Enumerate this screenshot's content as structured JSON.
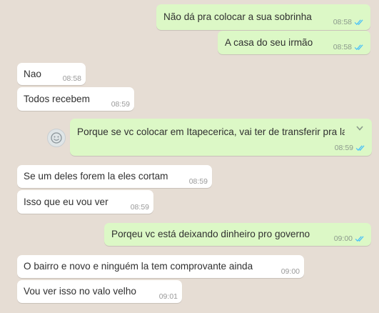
{
  "messages": [
    {
      "text": "Não dá pra colocar a sua sobrinha",
      "time": "08:58",
      "direction": "out",
      "read": true
    },
    {
      "text": "A casa do seu irmão",
      "time": "08:58",
      "direction": "out",
      "read": true
    },
    {
      "text": "Nao",
      "time": "08:58",
      "direction": "in"
    },
    {
      "text": "Todos recebem",
      "time": "08:59",
      "direction": "in"
    },
    {
      "text": "Porque se vc colocar em Itapecerica, vai ter de transferir pra la",
      "time": "08:59",
      "direction": "out",
      "read": true
    },
    {
      "text": "Se um deles forem la eles cortam",
      "time": "08:59",
      "direction": "in"
    },
    {
      "text": "Isso que eu vou ver",
      "time": "08:59",
      "direction": "in"
    },
    {
      "text": "Porqeu vc está deixando dinheiro pro governo",
      "time": "09:00",
      "direction": "out",
      "read": true
    },
    {
      "text": "O bairro e novo e ninguém la tem comprovante ainda",
      "time": "09:00",
      "direction": "in"
    },
    {
      "text": "Vou ver isso no valo velho",
      "time": "09:01",
      "direction": "in"
    }
  ],
  "colors": {
    "background": "#e6ddd4",
    "outgoing_bubble": "#dcf8c6",
    "incoming_bubble": "#ffffff",
    "read_ticks": "#4fc3f7"
  },
  "icons": {
    "read_receipt": "double-check-icon",
    "menu": "chevron-down-icon",
    "avatar": "smiley-avatar-icon"
  }
}
